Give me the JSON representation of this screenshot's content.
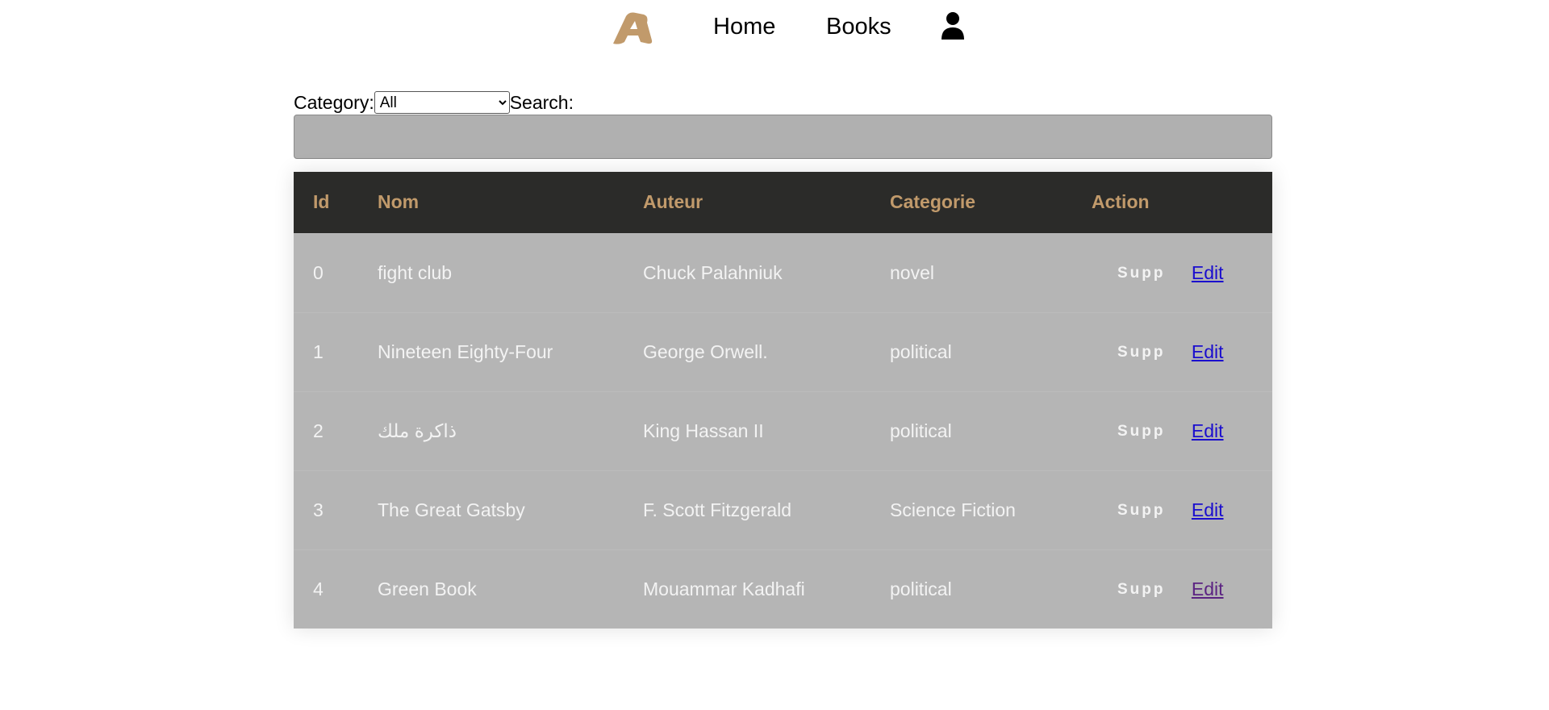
{
  "nav": {
    "home_label": "Home",
    "books_label": "Books",
    "logo_color": "#c19a6b"
  },
  "filters": {
    "category_label": "Category:",
    "category_selected": "All",
    "search_label": "Search:",
    "search_value": "",
    "search_placeholder": ""
  },
  "table": {
    "headers": {
      "id": "Id",
      "nom": "Nom",
      "auteur": "Auteur",
      "categorie": "Categorie",
      "action": "Action"
    },
    "rows": [
      {
        "id": "0",
        "nom": "fight club",
        "auteur": "Chuck Palahniuk",
        "categorie": "novel",
        "supp": "Supp",
        "edit": "Edit"
      },
      {
        "id": "1",
        "nom": "Nineteen Eighty-Four",
        "auteur": "George Orwell.",
        "categorie": "political",
        "supp": "Supp",
        "edit": "Edit"
      },
      {
        "id": "2",
        "nom": "ذاكرة ملك",
        "auteur": "King Hassan II",
        "categorie": "political",
        "supp": "Supp",
        "edit": "Edit"
      },
      {
        "id": "3",
        "nom": "The Great Gatsby",
        "auteur": "F. Scott Fitzgerald",
        "categorie": "Science Fiction",
        "supp": "Supp",
        "edit": "Edit"
      },
      {
        "id": "4",
        "nom": "Green Book",
        "auteur": "Mouammar Kadhafi",
        "categorie": "political",
        "supp": "Supp",
        "edit": "Edit"
      }
    ]
  },
  "colors": {
    "header_bg": "#2b2b29",
    "header_text": "#c19a6b",
    "row_bg": "#b5b5b5",
    "row_text": "#f3f3f3",
    "link": "#1a0dce",
    "link_visited": "#5b2382"
  }
}
